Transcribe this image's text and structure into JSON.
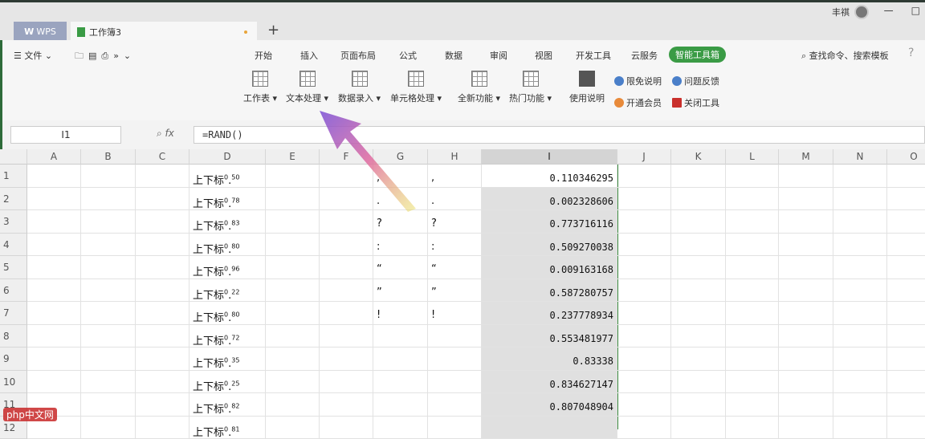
{
  "titlebar": {
    "wps_tab": "WPS",
    "book_tab": "工作簿3",
    "new_tab": "+",
    "user": "丰祺",
    "min": "—",
    "max": "□"
  },
  "menu": {
    "file": "文件",
    "tabs": [
      "开始",
      "插入",
      "页面布局",
      "公式",
      "数据",
      "审阅",
      "视图",
      "开发工具",
      "云服务"
    ],
    "active_tab": "智能工具箱",
    "search": "查找命令、搜索模板",
    "help": "?"
  },
  "ribbon": {
    "buttons": [
      "工作表",
      "文本处理",
      "数据录入",
      "单元格处理",
      "全新功能",
      "热门功能"
    ],
    "manual": "使用说明",
    "small": [
      "限免说明",
      "问题反馈",
      "开通会员",
      "关闭工具"
    ]
  },
  "formula_bar": {
    "cell_ref": "I1",
    "fx": "fx",
    "formula": "=RAND()"
  },
  "columns": [
    "A",
    "B",
    "C",
    "D",
    "E",
    "F",
    "G",
    "H",
    "I",
    "J",
    "K",
    "L",
    "M",
    "N",
    "O"
  ],
  "rows": [
    {
      "n": "1",
      "d_prefix": "上下标",
      "d_a": "0",
      "d_b": "50",
      "g": ",",
      "h": ",",
      "i": "0.110346295"
    },
    {
      "n": "2",
      "d_prefix": "上下标",
      "d_a": "0",
      "d_b": "78",
      "g": ".",
      "h": ".",
      "i": "0.002328606"
    },
    {
      "n": "3",
      "d_prefix": "上下标",
      "d_a": "0",
      "d_b": "83",
      "g": "?",
      "h": "?",
      "i": "0.773716116"
    },
    {
      "n": "4",
      "d_prefix": "上下标",
      "d_a": "0",
      "d_b": "80",
      "g": ":",
      "h": ":",
      "i": "0.509270038"
    },
    {
      "n": "5",
      "d_prefix": "上下标",
      "d_a": "0",
      "d_b": "96",
      "g": "“",
      "h": "“",
      "i": "0.009163168"
    },
    {
      "n": "6",
      "d_prefix": "上下标",
      "d_a": "0",
      "d_b": "22",
      "g": "”",
      "h": "”",
      "i": "0.587280757"
    },
    {
      "n": "7",
      "d_prefix": "上下标",
      "d_a": "0",
      "d_b": "80",
      "g": "!",
      "h": "!",
      "i": "0.237778934"
    },
    {
      "n": "8",
      "d_prefix": "上下标",
      "d_a": "0",
      "d_b": "72",
      "g": "",
      "h": "",
      "i": "0.553481977"
    },
    {
      "n": "9",
      "d_prefix": "上下标",
      "d_a": "0",
      "d_b": "35",
      "g": "",
      "h": "",
      "i": "0.83338"
    },
    {
      "n": "10",
      "d_prefix": "上下标",
      "d_a": "0",
      "d_b": "25",
      "g": "",
      "h": "",
      "i": "0.834627147"
    },
    {
      "n": "11",
      "d_prefix": "上下标",
      "d_a": "0",
      "d_b": "82",
      "g": "",
      "h": "",
      "i": "0.807048904"
    },
    {
      "n": "12",
      "d_prefix": "上下标",
      "d_a": "0",
      "d_b": "81",
      "g": "",
      "h": "",
      "i": ""
    }
  ],
  "watermark": "php中文网"
}
